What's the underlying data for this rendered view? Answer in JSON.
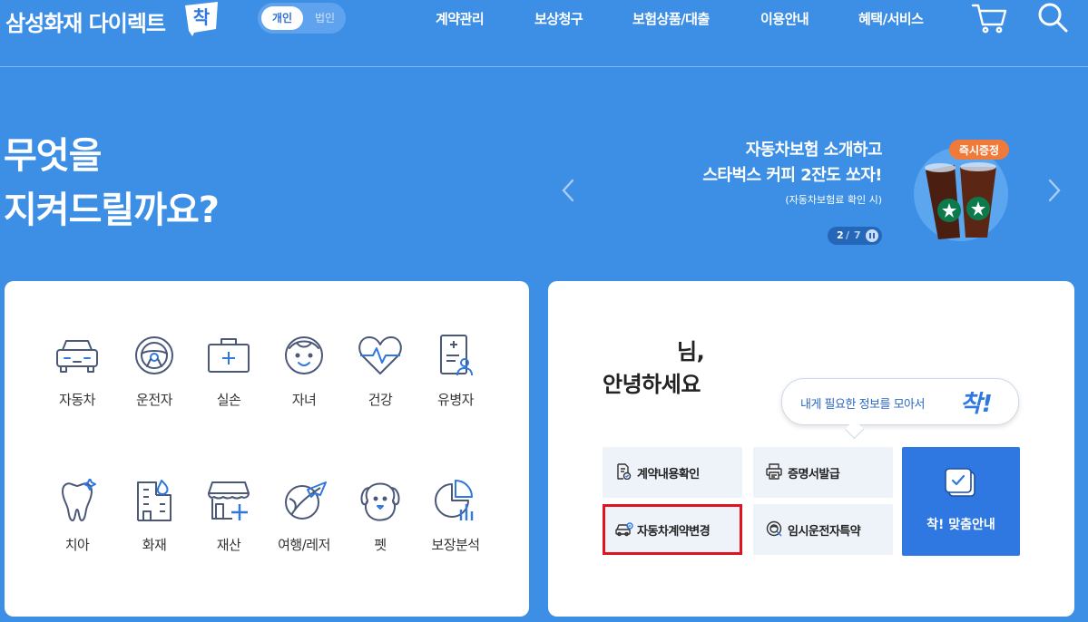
{
  "header": {
    "logo_text": "삼성화재 다이렉트",
    "logo_badge": "착",
    "toggle": {
      "active": "개인",
      "inactive": "법인"
    },
    "nav": [
      "계약관리",
      "보상청구",
      "보험상품/대출",
      "이용안내",
      "혜택/서비스"
    ],
    "icons": [
      "cart-icon",
      "search-icon"
    ]
  },
  "hero": {
    "title_line1": "무엇을",
    "title_line2": "지켜드릴까요?",
    "promo": {
      "line1": "자동차보험 소개하고",
      "line2": "스타벅스 커피 2잔도 쏘자!",
      "note": "(자동차보험료 확인 시)",
      "badge": "즉시증정",
      "page_current": "2",
      "page_sep": "/",
      "page_total": "7"
    }
  },
  "categories": [
    {
      "label": "자동차",
      "icon": "car-icon"
    },
    {
      "label": "운전자",
      "icon": "steering-wheel-icon"
    },
    {
      "label": "실손",
      "icon": "first-aid-kit-icon"
    },
    {
      "label": "자녀",
      "icon": "child-face-icon"
    },
    {
      "label": "건강",
      "icon": "heartbeat-icon"
    },
    {
      "label": "유병자",
      "icon": "medical-chart-icon"
    },
    {
      "label": "치아",
      "icon": "tooth-icon"
    },
    {
      "label": "화재",
      "icon": "building-fire-icon"
    },
    {
      "label": "재산",
      "icon": "store-icon"
    },
    {
      "label": "여행/레저",
      "icon": "airplane-globe-icon"
    },
    {
      "label": "펫",
      "icon": "pet-icon"
    },
    {
      "label": "보장분석",
      "icon": "pie-chart-icon"
    }
  ],
  "account": {
    "greeting_name": "님,",
    "greeting": "안녕하세요",
    "bubble_text": "내게 필요한 정보를 모아서",
    "bubble_mark": "착!",
    "quick_menu": [
      {
        "label": "계약내용확인",
        "icon": "document-check-icon"
      },
      {
        "label": "증명서발급",
        "icon": "printer-icon"
      },
      {
        "label": "자동차계약변경",
        "icon": "car-change-icon"
      },
      {
        "label": "임시운전자특약",
        "icon": "temp-driver-icon"
      }
    ],
    "main_button": "착! 맞춤안내"
  },
  "colors": {
    "background": "#3d8fe6",
    "accent": "#2f78e1",
    "highlight": "#e0141e",
    "icon_stroke": "#4b5878"
  }
}
